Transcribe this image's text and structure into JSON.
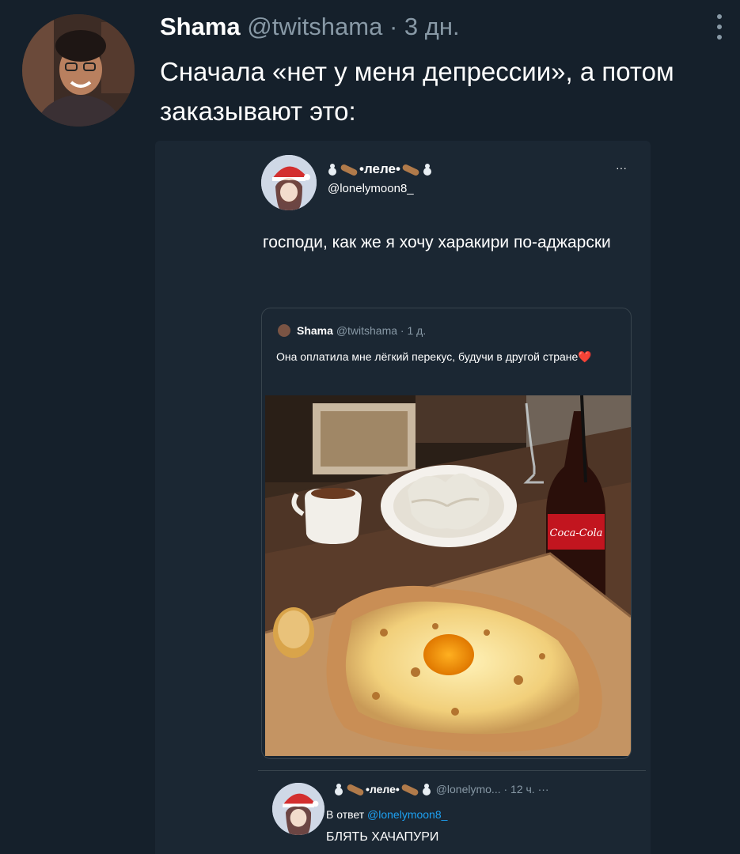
{
  "tweet": {
    "name": "Shama",
    "handle": "@twitshama",
    "separator": "·",
    "time": "3 дн.",
    "text": "Сначала «нет у меня депрессии», а потом заказывают это:"
  },
  "embedded": {
    "post": {
      "display_name": "•леле•",
      "handle": "@lonelymoon8_",
      "more": "···",
      "text": "господи, как же я хочу харакири по-аджарски"
    },
    "quote": {
      "name": "Shama",
      "handle_time": "@twitshama · 1 д.",
      "text": "Она оплатила мне лёгкий перекус, будучи в другой стране",
      "heart": "❤️"
    },
    "photo_labels": {
      "cola": "Coca-Cola"
    },
    "reply": {
      "display_name": "•леле•",
      "handle_time": "@lonelymo... · 12 ч.",
      "more": "···",
      "reply_to_prefix": "В ответ",
      "reply_to_handle": "@lonelymoon8_",
      "text": "БЛЯТЬ ХАЧАПУРИ"
    }
  },
  "colors": {
    "background": "#15202b",
    "secondary_text": "#8899a6",
    "link": "#1da1f2"
  },
  "icons": [
    "more-vertical-icon",
    "more-horizontal-icon",
    "snowman-icon",
    "sausage-icon",
    "heart-icon"
  ]
}
